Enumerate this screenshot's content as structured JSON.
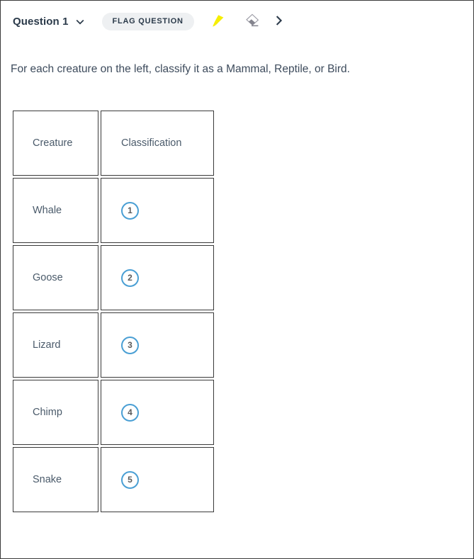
{
  "toolbar": {
    "question_label": "Question 1",
    "dropdown_icon": "chevron-down-icon",
    "flag_label": "FLAG QUESTION",
    "highlighter_icon": "highlighter-icon",
    "eraser_icon": "eraser-icon",
    "next_icon": "chevron-right-icon",
    "highlighter_color": "#f5ee00",
    "eraser_color": "#8c8c96",
    "accent_color": "#4a9fd4",
    "pill_bg": "#eef0f2",
    "title_color": "#2b3a4a"
  },
  "prompt": {
    "text": "For each creature on the left, classify it as a Mammal, Reptile, or Bird."
  },
  "matrix": {
    "headers": [
      "Creature",
      "Classification"
    ],
    "rows": [
      {
        "creature": "Whale",
        "marker": "1"
      },
      {
        "creature": "Goose",
        "marker": "2"
      },
      {
        "creature": "Lizard",
        "marker": "3"
      },
      {
        "creature": "Chimp",
        "marker": "4"
      },
      {
        "creature": "Snake",
        "marker": "5"
      }
    ]
  }
}
